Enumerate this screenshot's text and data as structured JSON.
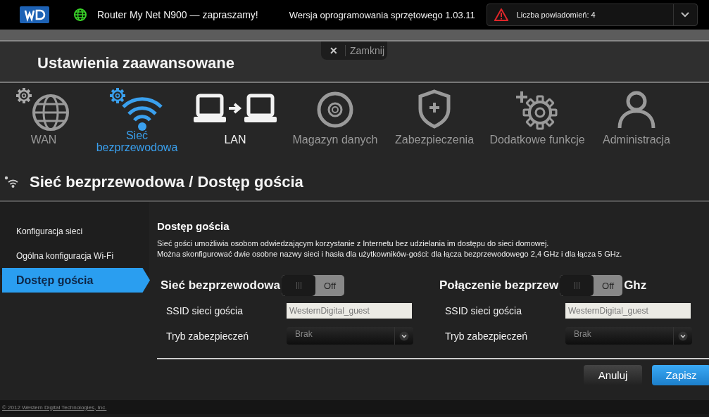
{
  "header": {
    "greeting": "Router My Net N900 — zapraszamy!",
    "firmware": "Wersja oprogramowania sprzętowego 1.03.11",
    "notifications": "Liczba powiadomień: 4"
  },
  "close_tab": {
    "icon": "✕",
    "label": "Zamknij"
  },
  "page_title": "Ustawienia zaawansowane",
  "nav": [
    {
      "label": "WAN",
      "selected": false,
      "highlighted": false
    },
    {
      "label": "Sieć bezprzewodowa",
      "selected": true,
      "highlighted": false
    },
    {
      "label": "LAN",
      "selected": false,
      "highlighted": true
    },
    {
      "label": "Magazyn danych",
      "selected": false,
      "highlighted": false
    },
    {
      "label": "Zabezpieczenia",
      "selected": false,
      "highlighted": false
    },
    {
      "label": "Dodatkowe funkcje",
      "selected": false,
      "highlighted": false
    },
    {
      "label": "Administracja",
      "selected": false,
      "highlighted": false
    }
  ],
  "section_title": "Sieć bezprzewodowa / Dostęp gościa",
  "sidebar": {
    "items": [
      {
        "label": "Konfiguracja sieci",
        "selected": false
      },
      {
        "label": "Ogólna konfiguracja Wi-Fi",
        "selected": false
      },
      {
        "label": "Dostęp gościa",
        "selected": true
      }
    ]
  },
  "panel": {
    "title": "Dostęp gościa",
    "description": [
      "Sieć gości umożliwia osobom odwiedzającym korzystanie z Internetu bez udzielania im dostępu do sieci domowej.",
      "Można skonfigurować dwie osobne nazwy sieci i hasła dla użytkowników-gości: dla łącza bezprzewodowego 2,4 GHz i dla łącza 5 GHz."
    ],
    "networks": [
      {
        "title": "Sieć bezprzewodowa",
        "toggle": {
          "on": false,
          "label": "Off"
        },
        "ssid_label": "SSID sieci gościa",
        "ssid": "WesternDigital_guest",
        "security_label": "Tryb zabezpieczeń",
        "security": "Brak"
      },
      {
        "title": "Połączenie bezprzew",
        "title_after": "Ghz",
        "toggle": {
          "on": false,
          "label": "Off"
        },
        "ssid_label": "SSID sieci gościa",
        "ssid": "WesternDigital_guest",
        "security_label": "Tryb zabezpieczeń",
        "security": "Brak"
      }
    ]
  },
  "buttons": [
    {
      "label": "Anuluj",
      "kind": "secondary"
    },
    {
      "label": "Zapisz",
      "kind": "primary"
    }
  ],
  "footer": "© 2012 Western Digital Technologies, Inc."
}
